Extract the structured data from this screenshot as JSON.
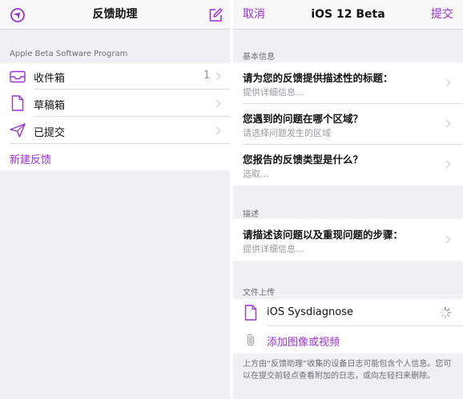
{
  "left": {
    "nav": {
      "title": "反馈助理"
    },
    "section_header": "Apple Beta Software Program",
    "items": [
      {
        "label": "收件箱",
        "count": "1"
      },
      {
        "label": "草稿箱",
        "count": ""
      },
      {
        "label": "已提交",
        "count": ""
      }
    ],
    "new_feedback": "新建反馈"
  },
  "right": {
    "nav": {
      "cancel": "取消",
      "title": "iOS 12 Beta",
      "submit": "提交"
    },
    "basic_header": "基本信息",
    "basic_rows": [
      {
        "title": "请为您的反馈提供描述性的标题：",
        "subtitle": "提供详细信息..."
      },
      {
        "title": "您遇到的问题在哪个区域？",
        "subtitle": "请选择问题发生的区域"
      },
      {
        "title": "您报告的反馈类型是什么？",
        "subtitle": "选取..."
      }
    ],
    "desc_header": "描述",
    "desc_row": {
      "title": "请描述该问题以及重现问题的步骤：",
      "subtitle": "提供详细信息..."
    },
    "upload_header": "文件上传",
    "upload_file": "iOS Sysdiagnose",
    "add_media": "添加图像或视频",
    "footer_note": "上方由“反馈助理”收集的设备日志可能包含个人信息。您可以在提交前轻点查看附加的日志，或向左轻扫来删除。"
  },
  "colors": {
    "accent": "#9b30d6",
    "background": "#efeff4",
    "separator": "#dcdcdf"
  },
  "icons": {
    "nav_left": "compass-icon",
    "nav_right": "compose-icon",
    "inbox": "inbox-tray-icon",
    "drafts": "document-icon",
    "sent": "paper-plane-icon",
    "file": "document-icon",
    "spinner": "activity-spinner-icon",
    "attach": "paperclip-icon"
  }
}
